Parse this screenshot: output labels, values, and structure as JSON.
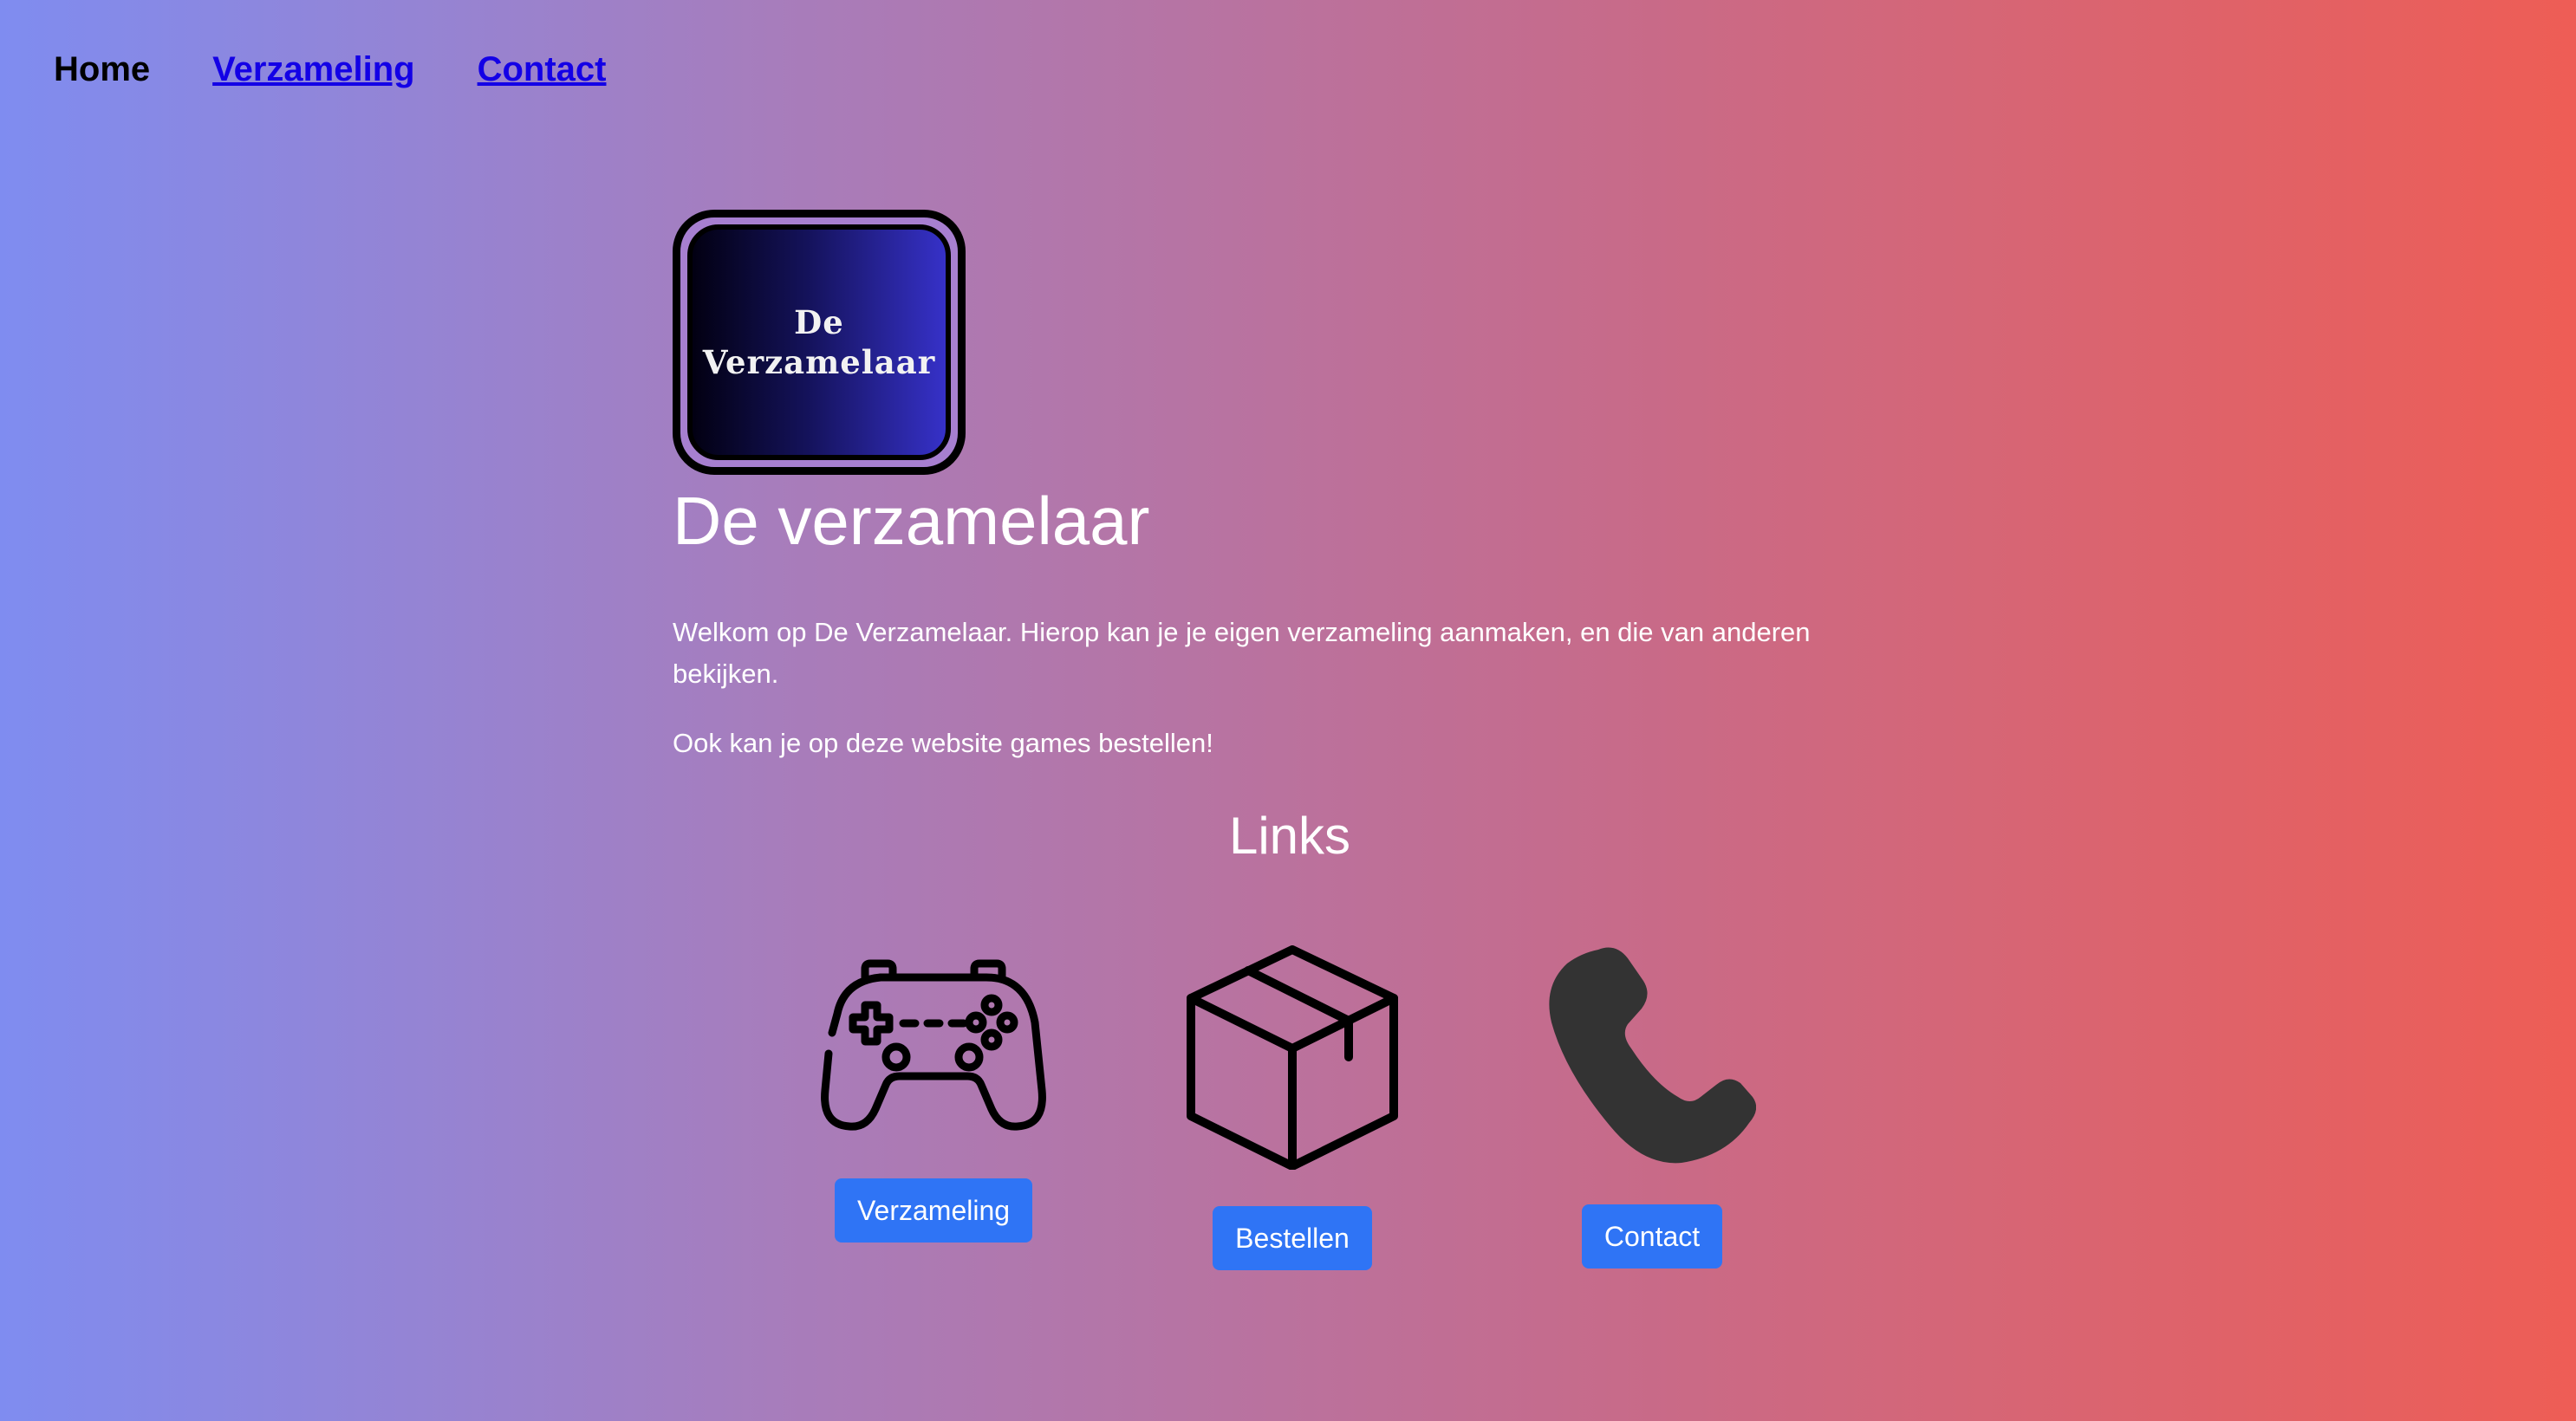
{
  "nav": {
    "home": "Home",
    "verzameling": "Verzameling",
    "contact": "Contact"
  },
  "logo": {
    "line1": "De",
    "line2": "Verzamelaar"
  },
  "hero": {
    "title": "De verzamelaar",
    "paragraph1": "Welkom op De Verzamelaar. Hierop kan je je eigen verzameling aanmaken, en die van anderen bekijken.",
    "paragraph2": "Ook kan je op deze website games bestellen!"
  },
  "links": {
    "title": "Links",
    "items": [
      {
        "icon": "gamepad-icon",
        "button": "Verzameling"
      },
      {
        "icon": "box-icon",
        "button": "Bestellen"
      },
      {
        "icon": "phone-icon",
        "button": "Contact"
      }
    ]
  },
  "colors": {
    "button": "#2f74f5",
    "nav_link": "#1300e6",
    "gradient_left": "#7f8cf0",
    "gradient_right": "#ee5d55"
  }
}
